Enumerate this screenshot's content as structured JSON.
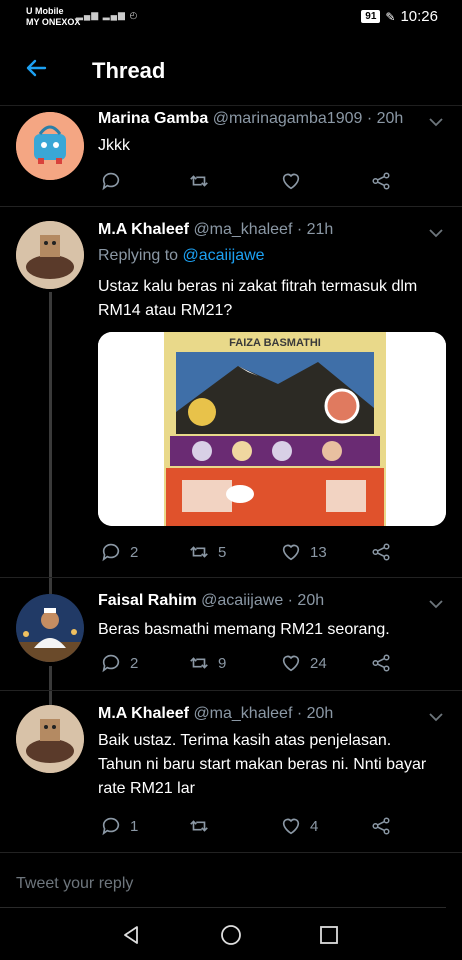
{
  "status": {
    "carrier1": "U Mobile",
    "carrier2": "MY ONEXOX",
    "battery": "91",
    "time": "10:26"
  },
  "header": {
    "title": "Thread"
  },
  "tweets": [
    {
      "name": "Marina Gamba",
      "handle": "@marinagamba1909 · 20h",
      "text": "Jkkk",
      "replies": "",
      "retweets": "",
      "likes": ""
    },
    {
      "name": "M.A Khaleef",
      "handle": "@ma_khaleef · 21h",
      "replying_prefix": "Replying to ",
      "replying_handle": "@acaiijawe",
      "text": "Ustaz kalu beras ni zakat fitrah termasuk dlm RM14 atau RM21?",
      "media_label": "FAIZA BASMATHI",
      "replies": "2",
      "retweets": "5",
      "likes": "13"
    },
    {
      "name": "Faisal Rahim",
      "handle": "@acaiijawe · 20h",
      "text": "Beras basmathi memang RM21 seorang.",
      "replies": "2",
      "retweets": "9",
      "likes": "24"
    },
    {
      "name": "M.A Khaleef",
      "handle": "@ma_khaleef · 20h",
      "text": "Baik ustaz. Terima kasih atas penjelasan. Tahun ni baru start makan beras ni. Nnti bayar rate RM21 lar",
      "replies": "1",
      "retweets": "",
      "likes": "4"
    }
  ],
  "composer": {
    "placeholder": "Tweet your reply"
  },
  "colors": {
    "accent": "#1da1f2",
    "muted": "#8b98a5",
    "background": "#000000"
  }
}
